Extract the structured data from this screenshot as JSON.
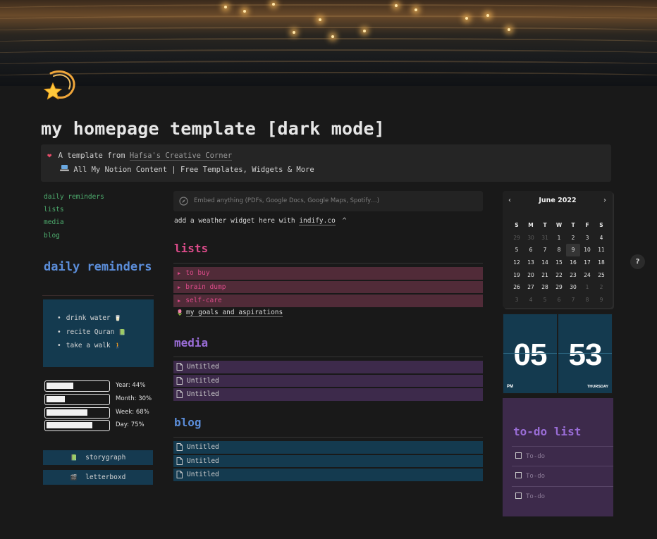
{
  "page": {
    "title": "my homepage template [dark mode]",
    "icon": "shooting-star-icon"
  },
  "callout": {
    "icon": "heart-icon",
    "prefix": "A template from ",
    "author_link": "Hafsa's Creative Corner",
    "line2_icon": "laptop-icon",
    "line2_text": "All My Notion Content | Free Templates, Widgets & More"
  },
  "nav": [
    "daily reminders",
    "lists",
    "media",
    "blog"
  ],
  "reminders": {
    "heading": "daily reminders",
    "items": [
      {
        "text": "drink water",
        "emoji": "🥛"
      },
      {
        "text": "recite Quran",
        "emoji": "📗"
      },
      {
        "text": "take a walk",
        "emoji": "🚶"
      }
    ]
  },
  "progress": [
    {
      "label": "Year: 44%",
      "value": 0.44
    },
    {
      "label": "Month: 30%",
      "value": 0.3
    },
    {
      "label": "Week: 68%",
      "value": 0.68
    },
    {
      "label": "Day: 75%",
      "value": 0.75
    }
  ],
  "links": [
    {
      "icon": "📗",
      "label": "storygraph"
    },
    {
      "icon": "🎬",
      "label": "letterboxd"
    }
  ],
  "embed": {
    "placeholder": "Embed anything (PDFs, Google Docs, Google Maps, Spotify…)"
  },
  "weather": {
    "prefix": "add a weather widget here with ",
    "link": "indify.co",
    "caret": "^"
  },
  "lists": {
    "heading": "lists",
    "toggles": [
      "to buy",
      "brain dump",
      "self-care"
    ],
    "goal": {
      "emoji": "🌷",
      "text": "my goals and aspirations"
    }
  },
  "media": {
    "heading": "media",
    "pages": [
      "Untitled",
      "Untitled",
      "Untitled"
    ]
  },
  "blog": {
    "heading": "blog",
    "pages": [
      "Untitled",
      "Untitled",
      "Untitled"
    ]
  },
  "calendar": {
    "month": "June 2022",
    "prev": "‹",
    "next": "›",
    "weekdays": [
      "S",
      "M",
      "T",
      "W",
      "T",
      "F",
      "S"
    ],
    "days": [
      [
        "29",
        "30",
        "31",
        "1",
        "2",
        "3",
        "4"
      ],
      [
        "5",
        "6",
        "7",
        "8",
        "9",
        "10",
        "11"
      ],
      [
        "12",
        "13",
        "14",
        "15",
        "16",
        "17",
        "18"
      ],
      [
        "19",
        "20",
        "21",
        "22",
        "23",
        "24",
        "25"
      ],
      [
        "26",
        "27",
        "28",
        "29",
        "30",
        "1",
        "2"
      ],
      [
        "3",
        "4",
        "5",
        "6",
        "7",
        "8",
        "9"
      ]
    ],
    "today": "9"
  },
  "clock": {
    "hour": "05",
    "minute": "53",
    "ampm": "PM",
    "day": "THURSDAY"
  },
  "todo": {
    "heading": "to-do list",
    "items": [
      "To-do",
      "To-do",
      "To-do"
    ]
  },
  "help": "?",
  "colors": {
    "background": "#191919",
    "green_link": "#4dab6d",
    "blue_heading": "#5b8dd9",
    "pink": "#dc4b8a",
    "purple_heading": "#9a6dd7",
    "blue_block": "#143a4f",
    "pink_block": "#512b38",
    "purple_block": "#3d2a4b"
  }
}
